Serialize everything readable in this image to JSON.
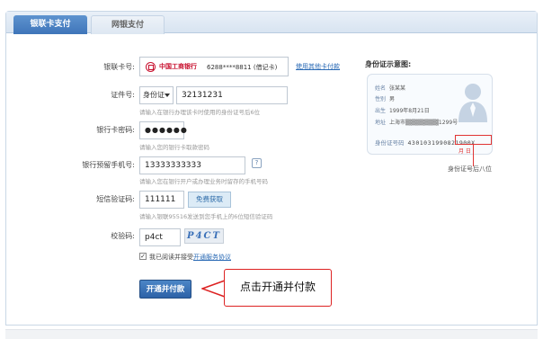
{
  "tabs": [
    {
      "label": "银联卡支付"
    },
    {
      "label": "网银支付"
    }
  ],
  "form": {
    "card_label": "银联卡号:",
    "bank_name": "中国工商银行",
    "card_value": "6288****8811 (借记卡)",
    "other_card_link": "使用其他卡付款",
    "id_label": "证件号:",
    "id_type": "身份证",
    "id_value": "32131231",
    "id_hint": "请输入在银行办理该卡时使用的身份证号后6位",
    "pwd_label": "银行卡密码:",
    "pwd_value": "●●●●●●",
    "pwd_hint": "请输入您的银行卡取款密码",
    "phone_label": "银行预留手机号:",
    "phone_value": "13333333333",
    "phone_help": "?",
    "phone_hint": "请输入您在银行开户或办理业务时留存的手机号码",
    "sms_label": "短信验证码:",
    "sms_value": "111111",
    "sms_button": "免费获取",
    "sms_hint": "请输入银联95516发送到您手机上的6位短信验证码",
    "captcha_label": "校验码:",
    "captcha_value": "p4ct",
    "captcha_image_text": "P4CT",
    "agree_check": "✓",
    "agree_text": "我已阅读并接受",
    "agree_link": "开通服务协议",
    "submit_button": "开通并付款"
  },
  "callout": {
    "text": "点击开通并付款"
  },
  "idcard": {
    "title": "身份证示意图:",
    "name_key": "姓名",
    "name_val": "张某某",
    "sex_key": "性别",
    "sex_val": "男",
    "birth_key": "出生",
    "birth_val": "1999年8月21日",
    "addr_key": "地址",
    "addr_val": "上海市▒▒▒▒▒▒▒▒1299号",
    "num_key": "身份证号码",
    "num_val": "430103199",
    "num_tail": "0821900X",
    "mark": "月 日",
    "caption": "身份证号后八位"
  },
  "colors": {
    "accent": "#3f75b9",
    "highlight": "#e03434"
  }
}
